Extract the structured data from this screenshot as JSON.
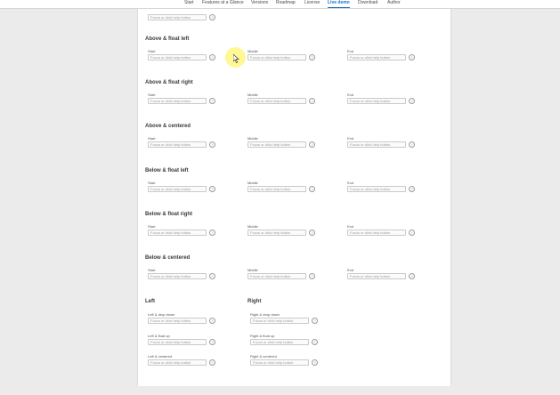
{
  "nav": {
    "items": [
      {
        "label": "Start",
        "active": false
      },
      {
        "label": "Features at a Glance",
        "active": false
      },
      {
        "label": "Versions",
        "active": false
      },
      {
        "label": "Roadmap",
        "active": false
      },
      {
        "label": "License",
        "active": false
      },
      {
        "label": "Live demo",
        "active": true
      },
      {
        "label": "Download",
        "active": false
      },
      {
        "label": "Author",
        "active": false
      }
    ]
  },
  "field_placeholder": "Focus or click help button",
  "help_icon": "help-icon",
  "columns": {
    "start": "Start",
    "middle": "Middle",
    "end": "End"
  },
  "sections": [
    {
      "title": "Above & float left"
    },
    {
      "title": "Above & float right"
    },
    {
      "title": "Above & centered"
    },
    {
      "title": "Below & float left"
    },
    {
      "title": "Below & float right"
    },
    {
      "title": "Below & centered"
    }
  ],
  "left": {
    "title": "Left",
    "fields": [
      {
        "label": "Left & drop down"
      },
      {
        "label": "Left & float up"
      },
      {
        "label": "Left & centered"
      }
    ]
  },
  "right": {
    "title": "Right",
    "fields": [
      {
        "label": "Right & drop down"
      },
      {
        "label": "Right & float up"
      },
      {
        "label": "Right & centered"
      }
    ]
  },
  "colors": {
    "accent": "#1a73c9",
    "highlight": "#fff23c"
  }
}
